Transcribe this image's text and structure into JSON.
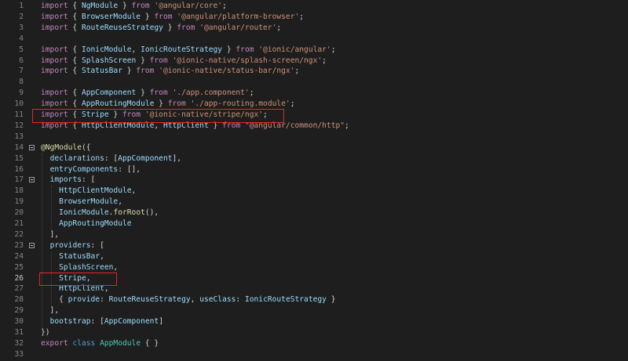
{
  "editor": {
    "language": "typescript",
    "active_line": 26,
    "colors": {
      "background": "#1e1e1e",
      "highlight_box": "#e3262a",
      "keyword": "#c586c0",
      "string": "#ce9178",
      "identifier": "#9cdcfe",
      "class": "#4ec9b0"
    },
    "lines": [
      {
        "n": "1",
        "tokens": [
          [
            "kw",
            "import"
          ],
          [
            "pn",
            " { "
          ],
          [
            "id",
            "NgModule"
          ],
          [
            "pn",
            " } "
          ],
          [
            "kw",
            "from"
          ],
          [
            "pn",
            " "
          ],
          [
            "str",
            "'@angular/core'"
          ],
          [
            "pn",
            ";"
          ]
        ]
      },
      {
        "n": "2",
        "tokens": [
          [
            "kw",
            "import"
          ],
          [
            "pn",
            " { "
          ],
          [
            "id",
            "BrowserModule"
          ],
          [
            "pn",
            " } "
          ],
          [
            "kw",
            "from"
          ],
          [
            "pn",
            " "
          ],
          [
            "str",
            "'@angular/platform-browser'"
          ],
          [
            "pn",
            ";"
          ]
        ]
      },
      {
        "n": "3",
        "tokens": [
          [
            "kw",
            "import"
          ],
          [
            "pn",
            " { "
          ],
          [
            "id",
            "RouteReuseStrategy"
          ],
          [
            "pn",
            " } "
          ],
          [
            "kw",
            "from"
          ],
          [
            "pn",
            " "
          ],
          [
            "str",
            "'@angular/router'"
          ],
          [
            "pn",
            ";"
          ]
        ]
      },
      {
        "n": "4",
        "tokens": []
      },
      {
        "n": "5",
        "tokens": [
          [
            "kw",
            "import"
          ],
          [
            "pn",
            " { "
          ],
          [
            "id",
            "IonicModule"
          ],
          [
            "pn",
            ", "
          ],
          [
            "id",
            "IonicRouteStrategy"
          ],
          [
            "pn",
            " } "
          ],
          [
            "kw",
            "from"
          ],
          [
            "pn",
            " "
          ],
          [
            "str",
            "'@ionic/angular'"
          ],
          [
            "pn",
            ";"
          ]
        ]
      },
      {
        "n": "6",
        "tokens": [
          [
            "kw",
            "import"
          ],
          [
            "pn",
            " { "
          ],
          [
            "id",
            "SplashScreen"
          ],
          [
            "pn",
            " } "
          ],
          [
            "kw",
            "from"
          ],
          [
            "pn",
            " "
          ],
          [
            "str",
            "'@ionic-native/splash-screen/ngx'"
          ],
          [
            "pn",
            ";"
          ]
        ]
      },
      {
        "n": "7",
        "tokens": [
          [
            "kw",
            "import"
          ],
          [
            "pn",
            " { "
          ],
          [
            "id",
            "StatusBar"
          ],
          [
            "pn",
            " } "
          ],
          [
            "kw",
            "from"
          ],
          [
            "pn",
            " "
          ],
          [
            "str",
            "'@ionic-native/status-bar/ngx'"
          ],
          [
            "pn",
            ";"
          ]
        ]
      },
      {
        "n": "8",
        "tokens": []
      },
      {
        "n": "9",
        "tokens": [
          [
            "kw",
            "import"
          ],
          [
            "pn",
            " { "
          ],
          [
            "id",
            "AppComponent"
          ],
          [
            "pn",
            " } "
          ],
          [
            "kw",
            "from"
          ],
          [
            "pn",
            " "
          ],
          [
            "str",
            "'./app.component'"
          ],
          [
            "pn",
            ";"
          ]
        ]
      },
      {
        "n": "10",
        "tokens": [
          [
            "kw",
            "import"
          ],
          [
            "pn",
            " { "
          ],
          [
            "id",
            "AppRoutingModule"
          ],
          [
            "pn",
            " } "
          ],
          [
            "kw",
            "from"
          ],
          [
            "pn",
            " "
          ],
          [
            "str",
            "'./app-routing.module'"
          ],
          [
            "pn",
            ";"
          ]
        ]
      },
      {
        "n": "11",
        "tokens": [
          [
            "kw",
            "import"
          ],
          [
            "pn",
            " { "
          ],
          [
            "id",
            "Stripe"
          ],
          [
            "pn",
            " } "
          ],
          [
            "kw",
            "from"
          ],
          [
            "pn",
            " "
          ],
          [
            "str",
            "'@ionic-native/stripe/ngx'"
          ],
          [
            "pn",
            ";"
          ]
        ]
      },
      {
        "n": "12",
        "tokens": [
          [
            "kw",
            "import"
          ],
          [
            "pn",
            " { "
          ],
          [
            "id",
            "HttpClientModule"
          ],
          [
            "pn",
            ", "
          ],
          [
            "id",
            "HttpClient"
          ],
          [
            "pn",
            " } "
          ],
          [
            "kw",
            "from"
          ],
          [
            "pn",
            " "
          ],
          [
            "str",
            "\"@angular/common/http\""
          ],
          [
            "pn",
            ";"
          ]
        ]
      },
      {
        "n": "13",
        "tokens": []
      },
      {
        "n": "14",
        "fold": true,
        "tokens": [
          [
            "dec",
            "@NgModule"
          ],
          [
            "pn",
            "({"
          ]
        ]
      },
      {
        "n": "15",
        "tokens": [
          [
            "pn",
            "  "
          ],
          [
            "id",
            "declarations"
          ],
          [
            "pn",
            ": ["
          ],
          [
            "id",
            "AppComponent"
          ],
          [
            "pn",
            "],"
          ]
        ]
      },
      {
        "n": "16",
        "tokens": [
          [
            "pn",
            "  "
          ],
          [
            "id",
            "entryComponents"
          ],
          [
            "pn",
            ": [],"
          ]
        ]
      },
      {
        "n": "17",
        "fold": true,
        "tokens": [
          [
            "pn",
            "  "
          ],
          [
            "id",
            "imports"
          ],
          [
            "pn",
            ": ["
          ]
        ]
      },
      {
        "n": "18",
        "tokens": [
          [
            "pn",
            "    "
          ],
          [
            "id",
            "HttpClientModule"
          ],
          [
            "pn",
            ","
          ]
        ]
      },
      {
        "n": "19",
        "tokens": [
          [
            "pn",
            "    "
          ],
          [
            "id",
            "BrowserModule"
          ],
          [
            "pn",
            ","
          ]
        ]
      },
      {
        "n": "20",
        "tokens": [
          [
            "pn",
            "    "
          ],
          [
            "id",
            "IonicModule"
          ],
          [
            "pn",
            "."
          ],
          [
            "fn",
            "forRoot"
          ],
          [
            "pn",
            "(),"
          ]
        ]
      },
      {
        "n": "21",
        "tokens": [
          [
            "pn",
            "    "
          ],
          [
            "id",
            "AppRoutingModule"
          ]
        ]
      },
      {
        "n": "22",
        "tokens": [
          [
            "pn",
            "  ],"
          ]
        ]
      },
      {
        "n": "23",
        "fold": true,
        "tokens": [
          [
            "pn",
            "  "
          ],
          [
            "id",
            "providers"
          ],
          [
            "pn",
            ": ["
          ]
        ]
      },
      {
        "n": "24",
        "tokens": [
          [
            "pn",
            "    "
          ],
          [
            "id",
            "StatusBar"
          ],
          [
            "pn",
            ","
          ]
        ]
      },
      {
        "n": "25",
        "tokens": [
          [
            "pn",
            "    "
          ],
          [
            "id",
            "SplashScreen"
          ],
          [
            "pn",
            ","
          ]
        ]
      },
      {
        "n": "26",
        "tokens": [
          [
            "pn",
            "    "
          ],
          [
            "id",
            "Stripe"
          ],
          [
            "pn",
            ","
          ]
        ]
      },
      {
        "n": "27",
        "tokens": [
          [
            "pn",
            "    "
          ],
          [
            "id",
            "HttpClient"
          ],
          [
            "pn",
            ","
          ]
        ]
      },
      {
        "n": "28",
        "tokens": [
          [
            "pn",
            "    { "
          ],
          [
            "id",
            "provide"
          ],
          [
            "pn",
            ": "
          ],
          [
            "id",
            "RouteReuseStrategy"
          ],
          [
            "pn",
            ", "
          ],
          [
            "id",
            "useClass"
          ],
          [
            "pn",
            ": "
          ],
          [
            "id",
            "IonicRouteStrategy"
          ],
          [
            "pn",
            " }"
          ]
        ]
      },
      {
        "n": "29",
        "tokens": [
          [
            "pn",
            "  ],"
          ]
        ]
      },
      {
        "n": "30",
        "tokens": [
          [
            "pn",
            "  "
          ],
          [
            "id",
            "bootstrap"
          ],
          [
            "pn",
            ": ["
          ],
          [
            "id",
            "AppComponent"
          ],
          [
            "pn",
            "]"
          ]
        ]
      },
      {
        "n": "31",
        "tokens": [
          [
            "pn",
            "})"
          ]
        ]
      },
      {
        "n": "32",
        "tokens": [
          [
            "kw",
            "export"
          ],
          [
            "pn",
            " "
          ],
          [
            "kw2",
            "class"
          ],
          [
            "pn",
            " "
          ],
          [
            "cls",
            "AppModule"
          ],
          [
            "pn",
            " { }"
          ]
        ]
      },
      {
        "n": "33",
        "tokens": []
      }
    ]
  }
}
